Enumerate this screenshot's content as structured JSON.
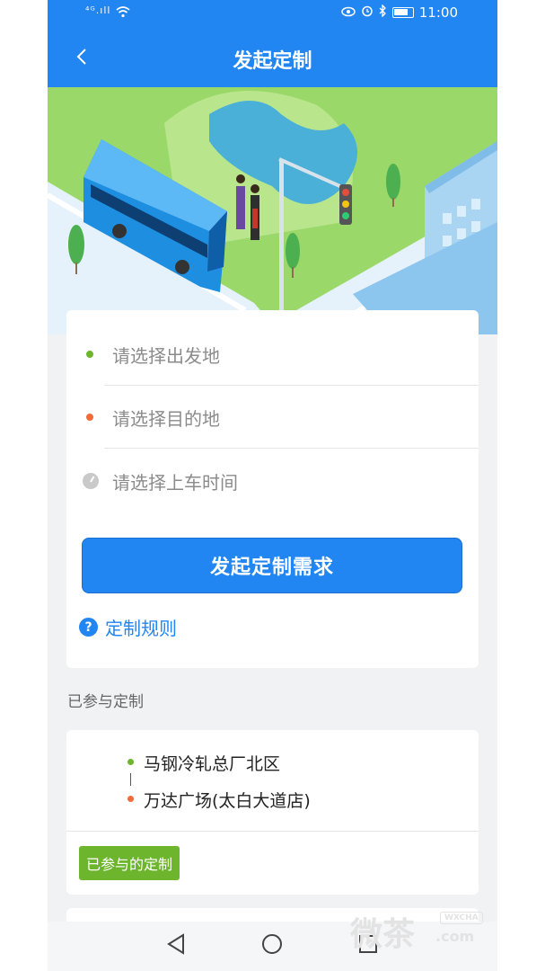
{
  "status_bar": {
    "network": "⁴ᴳ.ıll",
    "time": "11:00"
  },
  "header": {
    "title": "发起定制"
  },
  "form": {
    "origin_placeholder": "请选择出发地",
    "destination_placeholder": "请选择目的地",
    "time_placeholder": "请选择上车时间",
    "submit_label": "发起定制需求",
    "rules_label": "定制规则",
    "rules_icon_glyph": "?"
  },
  "joined": {
    "section_title": "已参与定制",
    "orders": [
      {
        "from": "马钢冷轧总厂北区",
        "to": "万达广场(太白大道店)",
        "badge": "已参与的定制"
      }
    ]
  },
  "watermark": {
    "cn": "微茶",
    "en": "WXCHA",
    "com": ".com"
  },
  "colors": {
    "primary": "#2185f2",
    "origin_dot": "#6cb52d",
    "destination_dot": "#f06a3a",
    "badge": "#6cb52d",
    "hero_grass": "#9bd86a",
    "hero_road": "#e6f2fb"
  },
  "icons": {
    "back": "chevron-left-icon",
    "eye": "eye-icon",
    "alarm": "alarm-icon",
    "bluetooth": "bluetooth-icon",
    "wifi": "wifi-icon",
    "battery": "battery-icon",
    "clock": "clock-icon",
    "rules": "question-circle-icon",
    "nav_back": "triangle-back-icon",
    "nav_home": "circle-home-icon",
    "nav_recent": "square-recent-icon"
  }
}
